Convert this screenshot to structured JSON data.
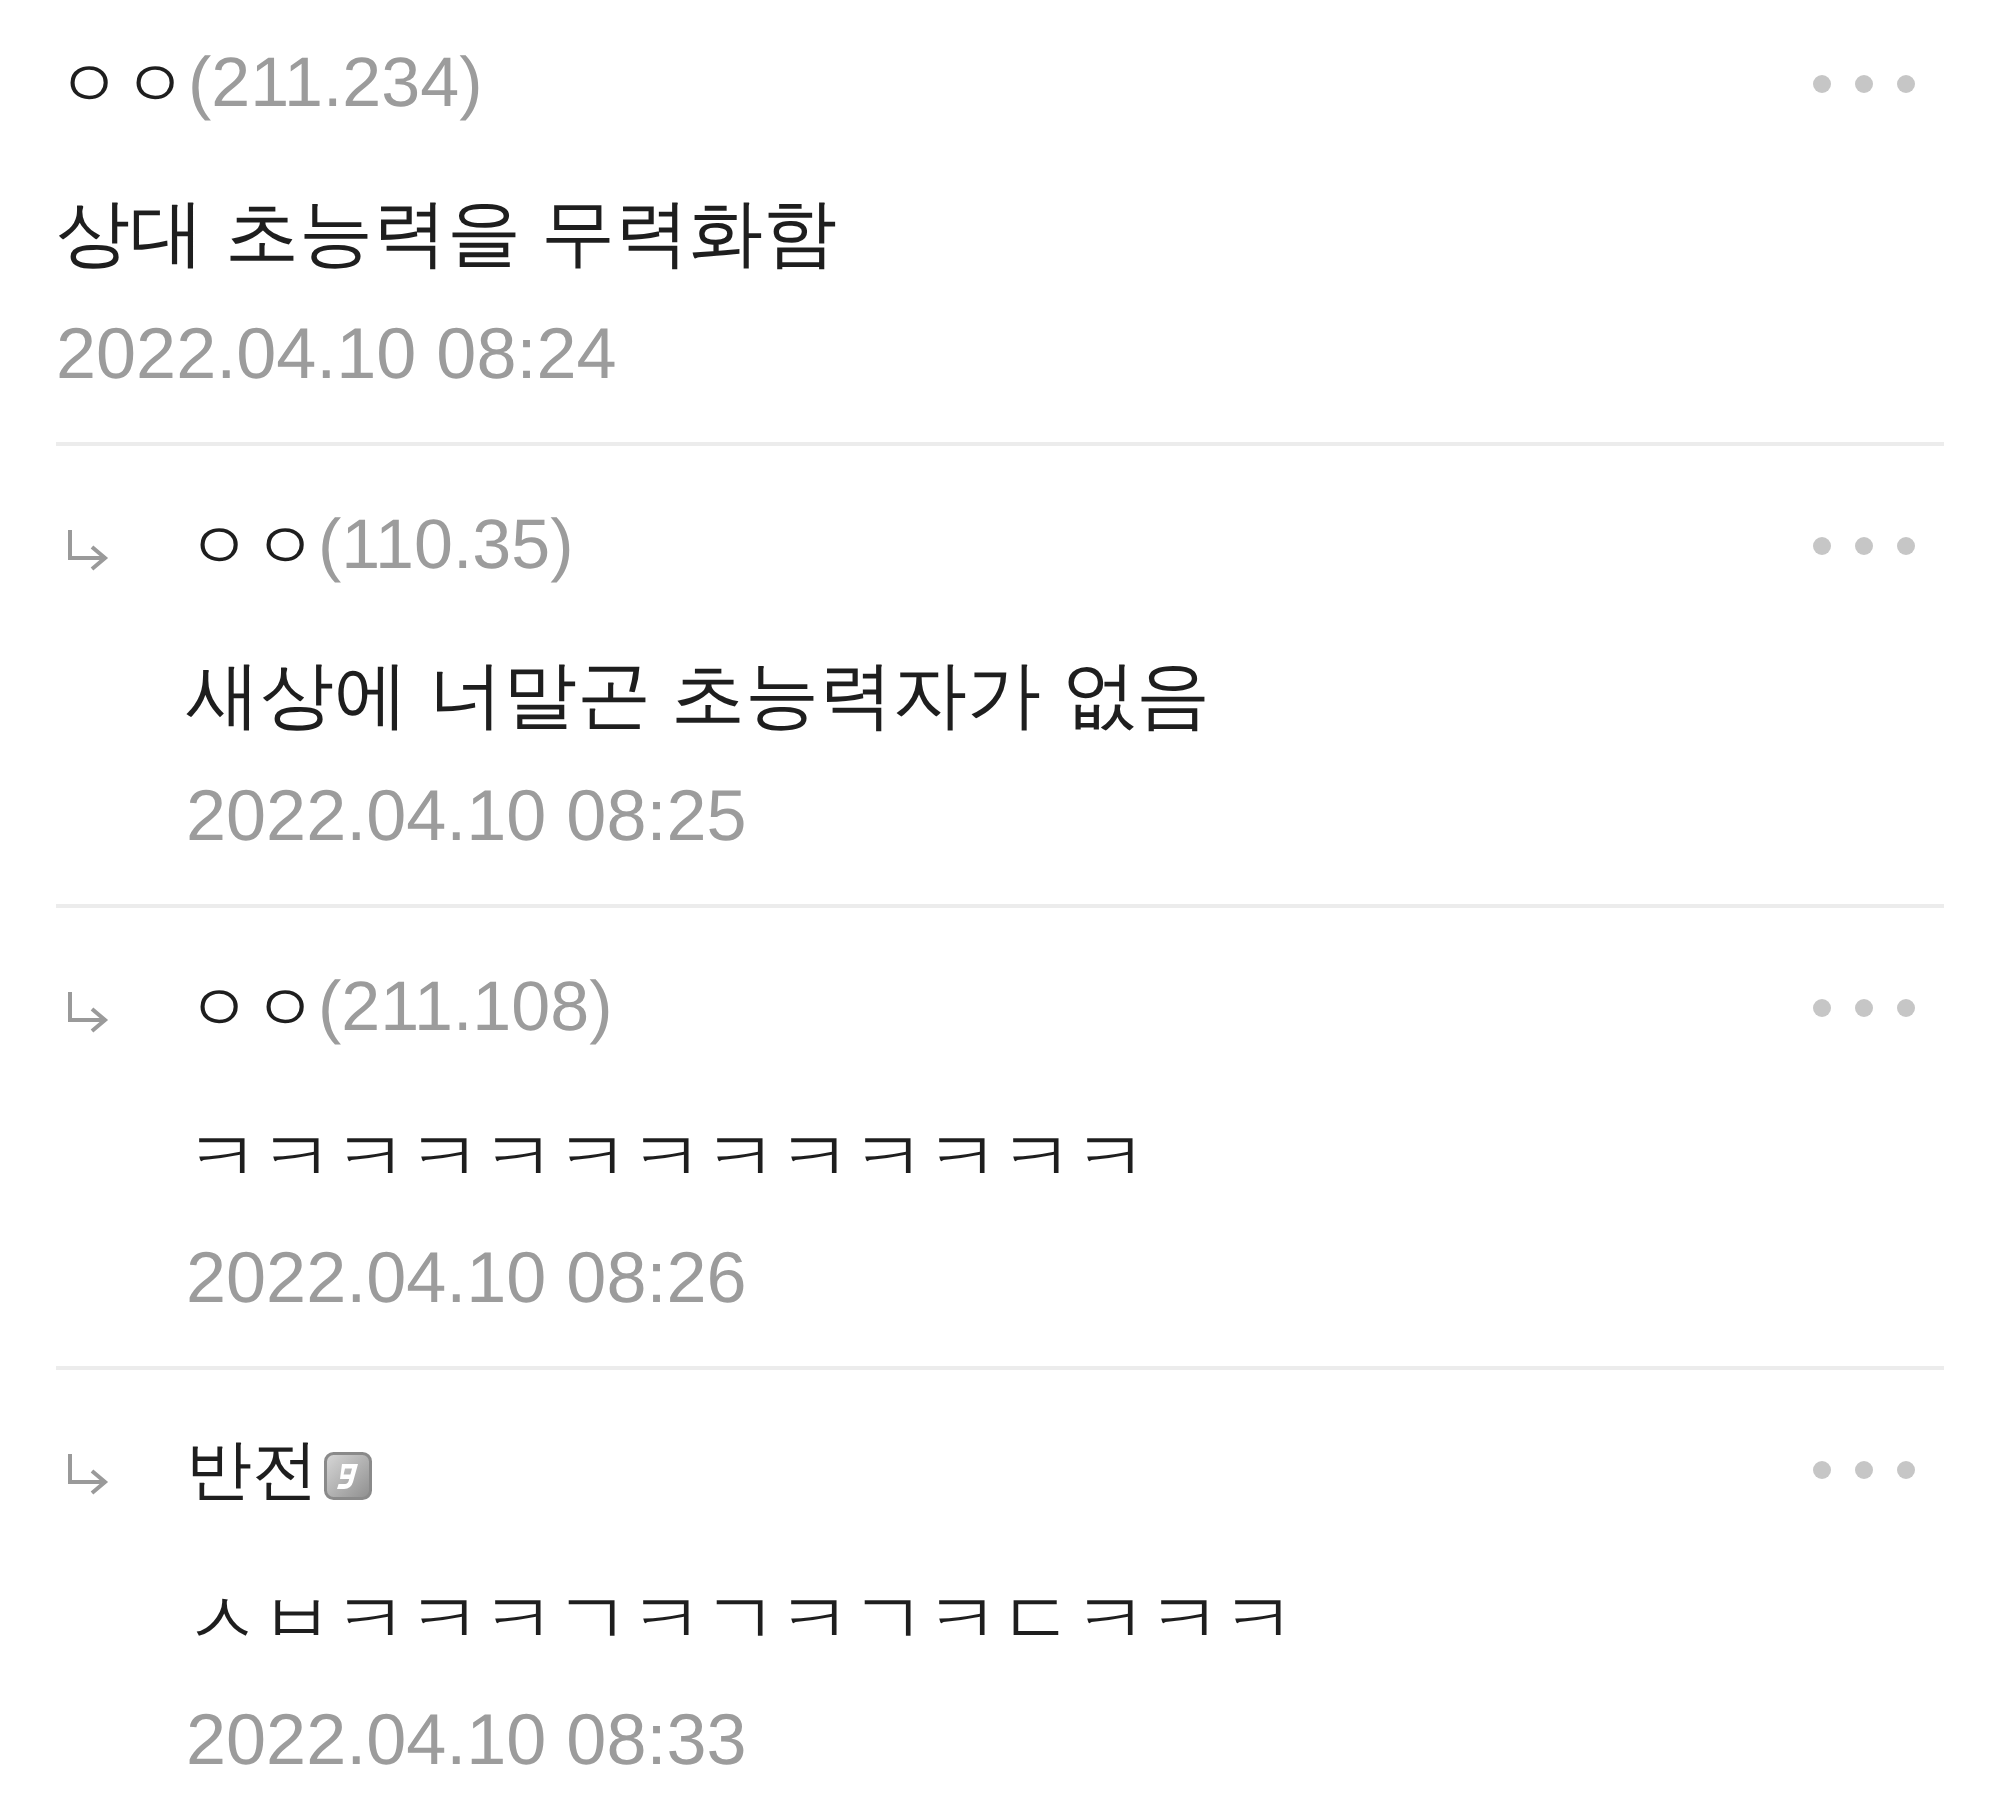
{
  "comments": [
    {
      "kind": "comment",
      "author": "ㅇㅇ",
      "ip": "(211.234)",
      "nick_badge": false,
      "text": "상대 초능력을 무력화함",
      "date": "2022.04.10 08:24"
    },
    {
      "kind": "reply",
      "author": "ㅇㅇ",
      "ip": "(110.35)",
      "nick_badge": false,
      "text": "새상에 너말곤 초능력자가 없음",
      "date": "2022.04.10 08:25"
    },
    {
      "kind": "reply",
      "author": "ㅇㅇ",
      "ip": "(211.108)",
      "nick_badge": false,
      "text": "ㅋㅋㅋㅋㅋㅋㅋㅋㅋㅋㅋㅋㅋ",
      "date": "2022.04.10 08:26"
    },
    {
      "kind": "reply",
      "author": "반전",
      "nick_badge": true,
      "text": "ㅅㅂㅋㅋㅋㄱㅋㄱㅋㄱㅋㄷㅋㅋㅋ",
      "date": "2022.04.10 08:33"
    }
  ]
}
